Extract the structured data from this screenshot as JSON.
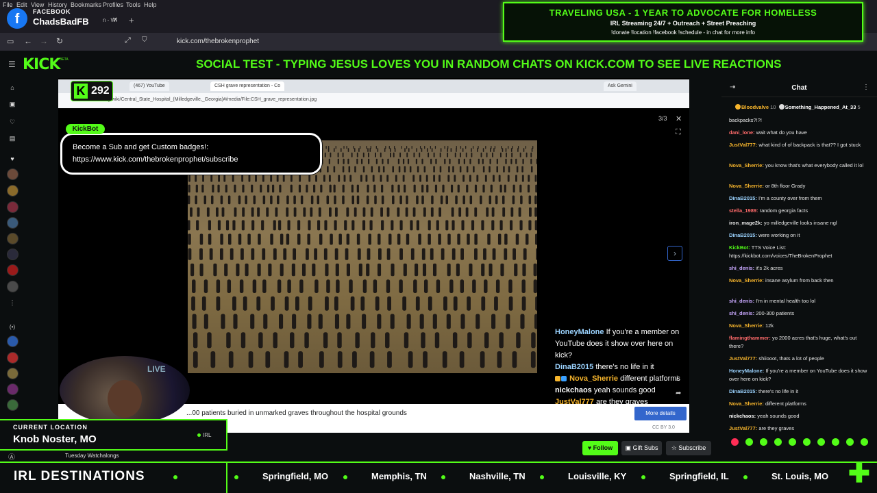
{
  "menubar": {
    "items": [
      "File",
      "Edit",
      "View",
      "History",
      "Bookmarks",
      "Profiles",
      "Tools",
      "Help"
    ]
  },
  "facebook": {
    "label": "FACEBOOK",
    "handle": "ChadsBadFB",
    "tab_suffix": "n - Wi"
  },
  "browser": {
    "url": "kick.com/thebrokenprophet"
  },
  "top_banner": {
    "line1": "TRAVELING USA - 1 YEAR TO ADVOCATE FOR HOMELESS",
    "line2": "IRL Streaming 24/7 + Outreach + Street Preaching",
    "line3": "!donate !location !facebook !schedule - in chat for more info"
  },
  "kick": {
    "logo": "KICK",
    "beta": "BETA",
    "marquee": "SOCIAL TEST - TYPING JESUS LOVES YOU IN RANDOM CHATS ON KICK.COM TO SEE LIVE REACTIONS"
  },
  "viewers": {
    "count": "292"
  },
  "inner_browser": {
    "tabs": [
      "Live",
      "(467) YouTube",
      "CSH grave representation - Co"
    ],
    "ask": "Ask Gemini",
    "url": "...org/wiki/Central_State_Hospital_(Milledgeville,_Georgia)#/media/File:CSH_grave_representation.jpg",
    "counter": "3/3",
    "caption": "...00 patients buried in unmarked graves throughout the hospital grounds",
    "more_details": "More details",
    "license": "CC BY 3.0"
  },
  "kickbot": {
    "tag": "KickBot",
    "line1": "Become a Sub and get Custom badges!:",
    "line2": "https://www.kick.com/thebrokenprophet/subscribe"
  },
  "overlay_chat": [
    {
      "user": "HoneyMalone",
      "text": "If you're a member on YouTube does it show over here on kick?",
      "color": "#9bd3ff"
    },
    {
      "user": "DinaB2015",
      "text": "there's no life in it",
      "color": "#9bd3ff"
    },
    {
      "user": "Nova_Sherrie",
      "text": "different platforms",
      "color": "#f7b52c"
    },
    {
      "user": "nickchaos",
      "text": "yeah sounds good",
      "color": "#ffffff"
    },
    {
      "user": "JustVal777",
      "text": "are they graves",
      "color": "#f7b52c"
    }
  ],
  "location": {
    "label": "CURRENT LOCATION",
    "value": "Knob Noster, MO",
    "tag": "IRL"
  },
  "channel_row": {
    "text": "Tuesday Watchalongs"
  },
  "actions": {
    "follow": "Follow",
    "gift": "Gift Subs",
    "subscribe": "Subscribe"
  },
  "destinations": {
    "title": "IRL DESTINATIONS",
    "cities": [
      "Springfield, MO",
      "Memphis, TN",
      "Nashville, TN",
      "Louisville, KY",
      "Springfield, IL",
      "St. Louis, MO"
    ]
  },
  "chat": {
    "title": "Chat",
    "top_users": [
      {
        "name": "Bloodvalve",
        "count": "10"
      },
      {
        "name": "Something_Happened_At_33",
        "count": "5"
      }
    ],
    "messages": [
      {
        "user": "",
        "text": "backpacks?!?!",
        "color": "#e6e6e6"
      },
      {
        "user": "dani_lone:",
        "text": "wait what do you have",
        "color": "#ff6b6b"
      },
      {
        "user": "JustVal777:",
        "text": "what kind of of backpack is that?? I got stuck",
        "color": "#f7b52c"
      },
      {
        "user": "Nova_Sherrie:",
        "text": "you know that's what everybody called it lol",
        "color": "#f7b52c"
      },
      {
        "user": "Nova_Sherrie:",
        "text": "or 8th floor Grady",
        "color": "#f7b52c"
      },
      {
        "user": "DinaB2015:",
        "text": "I'm a county over from them",
        "color": "#9bd3ff"
      },
      {
        "user": "stella_1989:",
        "text": "random georgia facts",
        "color": "#ff6b6b"
      },
      {
        "user": "iron_mage2k:",
        "text": "yo milledgeville looks insane ngl",
        "color": "#e6e6e6"
      },
      {
        "user": "DinaB2015:",
        "text": "were working on it",
        "color": "#9bd3ff"
      },
      {
        "user": "KickBot:",
        "text": "TTS Voice List: https://kickbot.com/voices/TheBrokenProphet",
        "color": "#53fc18"
      },
      {
        "user": "shi_denis:",
        "text": "it's 2k acres",
        "color": "#c9a8ff"
      },
      {
        "user": "Nova_Sherrie:",
        "text": "insane asylum from back then",
        "color": "#f7b52c"
      },
      {
        "user": "shi_denis:",
        "text": "I'm in mental health too lol",
        "color": "#c9a8ff"
      },
      {
        "user": "shi_denis:",
        "text": "200-300 patients",
        "color": "#c9a8ff"
      },
      {
        "user": "Nova_Sherrie:",
        "text": "12k",
        "color": "#f7b52c"
      },
      {
        "user": "flamingthammer:",
        "text": "yo 2000 acres that's huge, what's out there?",
        "color": "#ff6b6b"
      },
      {
        "user": "JustVal777:",
        "text": "shiiooot, thats a lot of people",
        "color": "#f7b52c"
      },
      {
        "user": "HoneyMalone:",
        "text": "If you're a member on YouTube does it show over here on kick?",
        "color": "#9bd3ff"
      },
      {
        "user": "DinaB2015:",
        "text": "there's no life in it",
        "color": "#9bd3ff"
      },
      {
        "user": "Nova_Sherrie:",
        "text": "different platforms",
        "color": "#f7b52c"
      },
      {
        "user": "nickchaos:",
        "text": "yeah sounds good",
        "color": "#ffffff"
      },
      {
        "user": "JustVal777:",
        "text": "are they graves",
        "color": "#f7b52c"
      }
    ]
  },
  "colors": {
    "accent": "#53fc18",
    "bg": "#0b0e0f"
  }
}
